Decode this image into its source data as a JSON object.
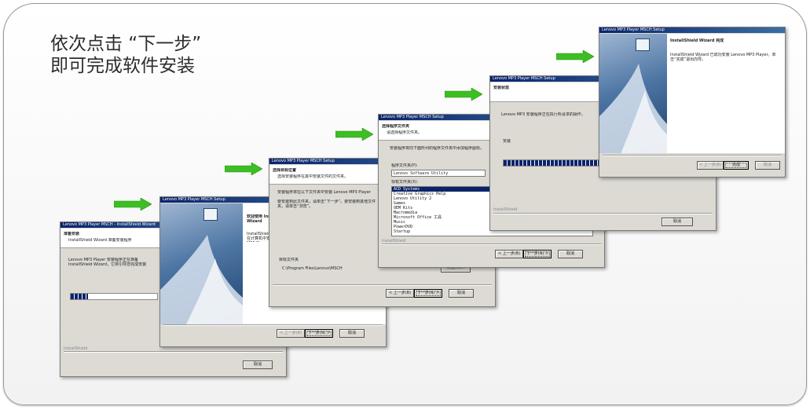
{
  "headline": {
    "line1": "依次点击 “下一步”",
    "line2": "即可完成软件安装"
  },
  "colors": {
    "arrow_green": "#3cbf22",
    "titlebar": "#0a246a",
    "dialog_bg": "#dcdad3"
  },
  "win1": {
    "title": "Lenovo MP3 Player MSCH - InstallShield Wizard",
    "heading": "准备安装",
    "subheading": "InstallShield Wizard 准备安装程序",
    "body": "Lenovo MP3 Player 安装程序正在准备 InstallShield Wizard，它将引导您完成安装",
    "footer": "InstallShield",
    "cancel": "取消"
  },
  "win2": {
    "title": "Lenovo MP3 Player MSCH Setup",
    "heading": "欢迎使用 InstallShield Wizard",
    "body": "InstallShield Wizard 将在计算机中安装 Lenovo MP3 Player",
    "back": "< 上一步(B)",
    "next": "下一步(N) >",
    "cancel": "取消"
  },
  "win3": {
    "title": "Lenovo MP3 Player MSCH Setup",
    "heading": "选择目标位置",
    "subheading": "选择安装程序在其中安装文件的文件夹。",
    "body1": "安装程序将在以下文件夹中安装 Lenovo MP3 Player",
    "body2": "要安装到此文件夹，请单击“下一步”。要安装到其他文件夹，请单击“浏览”。",
    "folder_label": "目标文件夹",
    "folder_path": "C:\\Program Files\\Lenovo\\MSCH",
    "browse": "浏览(R)...",
    "back": "< 上一步(B)",
    "next": "下一步(N) >",
    "cancel": "取消"
  },
  "win4": {
    "title": "Lenovo MP3 Player MSCH Setup",
    "heading": "选择程序文件夹",
    "subheading": "请选择程序文件夹。",
    "body": "安装程序将向下面所列的程序文件夹中添加程序图标。",
    "folder_label": "程序文件夹(P):",
    "folder_value": "Lenovo Software Utility",
    "existing_label": "现有文件夹(X):",
    "folders": [
      "ACD Systems",
      "Creative Graphics Help",
      "Lenovo Utility 2",
      "Games",
      "OEM Kits",
      "Macromedia",
      "Microsoft Office 工具",
      "Music",
      "PowerDVD",
      "Startup"
    ],
    "selected_index": 0,
    "footer": "InstallShield",
    "back": "< 上一步(B)",
    "next": "下一步(N) >",
    "cancel": "取消"
  },
  "win5": {
    "title": "Lenovo MP3 Player MSCH Setup",
    "heading": "安装状态",
    "body": "Lenovo MP3 安装程序正在执行所请求的操作。",
    "status": "安装",
    "progress": 0.96,
    "footer": "InstallShield",
    "cancel": "取消"
  },
  "win6": {
    "title": "Lenovo MP3 Player MSCH Setup",
    "heading": "InstallShield Wizard 完成",
    "body": "InstallShield Wizard 已成功安装 Lenovo MP3 Player。单击“完成”退出向导。",
    "back": "< 上一步(B)",
    "finish": "完成",
    "cancel": "取消"
  }
}
